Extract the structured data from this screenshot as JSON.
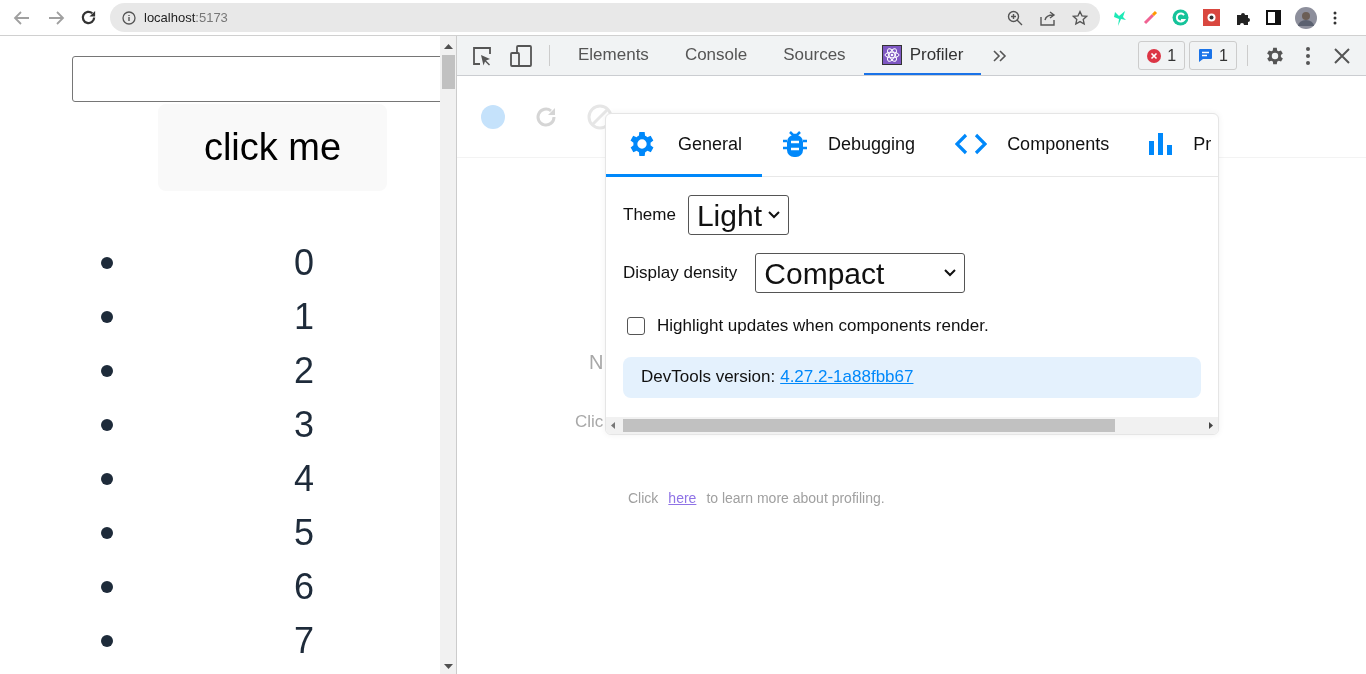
{
  "browser": {
    "url_host": "localhost",
    "url_port": ":5173"
  },
  "page": {
    "button": "click me",
    "items": [
      "0",
      "1",
      "2",
      "3",
      "4",
      "5",
      "6",
      "7"
    ]
  },
  "devtools": {
    "tabs": [
      {
        "label": "Elements",
        "selected": false,
        "kind": "plain"
      },
      {
        "label": "Console",
        "selected": false,
        "kind": "plain"
      },
      {
        "label": "Sources",
        "selected": false,
        "kind": "plain"
      },
      {
        "label": "Profiler",
        "selected": true,
        "kind": "extension"
      }
    ],
    "errors": "1",
    "messages": "1",
    "profiler": {
      "faded_1": "N",
      "faded_2": "Clic",
      "hint_before": "Click",
      "hint_link": "here",
      "hint_after": "to learn more about profiling."
    },
    "settings": {
      "tabs": [
        {
          "label": "General",
          "selected": true,
          "kind": "general"
        },
        {
          "label": "Debugging",
          "selected": false,
          "kind": "debugging"
        },
        {
          "label": "Components",
          "selected": false,
          "kind": "components"
        },
        {
          "label": "Pr",
          "selected": false,
          "kind": "profiler"
        }
      ],
      "theme": {
        "label": "Theme",
        "value": "Light"
      },
      "density": {
        "label": "Display density",
        "value": "Compact"
      },
      "highlight": {
        "label": "Highlight updates when components render.",
        "checked": false
      },
      "version": {
        "label": "DevTools version:",
        "link": "4.27.2-1a88fbb67"
      }
    }
  }
}
